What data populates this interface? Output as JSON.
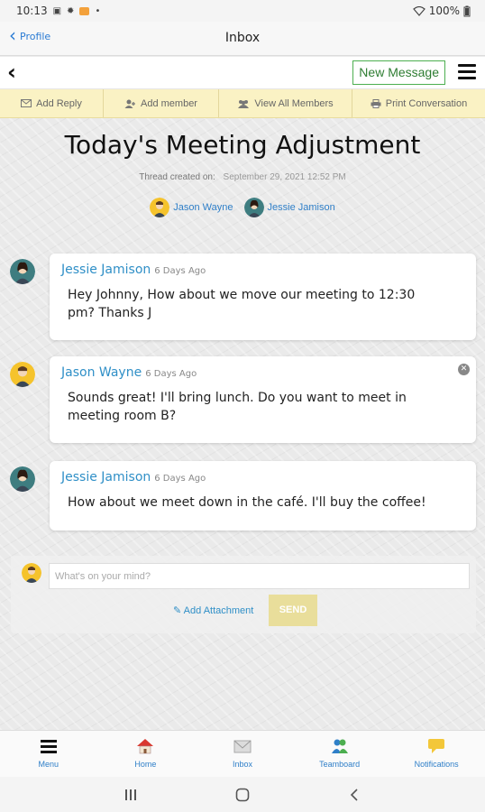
{
  "status_bar": {
    "time": "10:13",
    "battery": "100%"
  },
  "header": {
    "back_label": "Profile",
    "title": "Inbox"
  },
  "toolbar": {
    "new_message_label": "New Message"
  },
  "actions": [
    {
      "label": "Add Reply",
      "icon": "envelope-icon"
    },
    {
      "label": "Add member",
      "icon": "add-user-icon"
    },
    {
      "label": "View All Members",
      "icon": "members-icon"
    },
    {
      "label": "Print Conversation",
      "icon": "printer-icon"
    }
  ],
  "thread": {
    "title": "Today's Meeting Adjustment",
    "created_label": "Thread created on:",
    "created_date": "September 29, 2021 12:52 PM",
    "participants": [
      "Jason Wayne",
      "Jessie Jamison"
    ]
  },
  "messages": [
    {
      "author": "Jessie Jamison",
      "time": "6 Days Ago",
      "body": "Hey Johnny, How about we move our meeting to 12:30 pm? Thanks J",
      "avatar": "teal"
    },
    {
      "author": "Jason Wayne",
      "time": "6 Days Ago",
      "body": "Sounds great! I'll bring lunch. Do you want to meet in meeting room B?",
      "avatar": "yellow"
    },
    {
      "author": "Jessie Jamison",
      "time": "6 Days Ago",
      "body": "How about we meet down in the café. I'll buy the coffee!",
      "avatar": "teal"
    }
  ],
  "compose": {
    "placeholder": "What's on your mind?",
    "attach_label": "Add Attachment",
    "send_label": "SEND"
  },
  "bottom_nav": [
    {
      "label": "Menu",
      "icon": "menu-icon"
    },
    {
      "label": "Home",
      "icon": "home-icon"
    },
    {
      "label": "Inbox",
      "icon": "inbox-icon"
    },
    {
      "label": "Teamboard",
      "icon": "teamboard-icon"
    },
    {
      "label": "Notifications",
      "icon": "notifications-icon"
    }
  ],
  "colors": {
    "accent_blue": "#2f8fc7",
    "action_bar_bg": "#faf2c4",
    "new_message_border": "#4caf50",
    "send_button": "#e9de9b"
  }
}
